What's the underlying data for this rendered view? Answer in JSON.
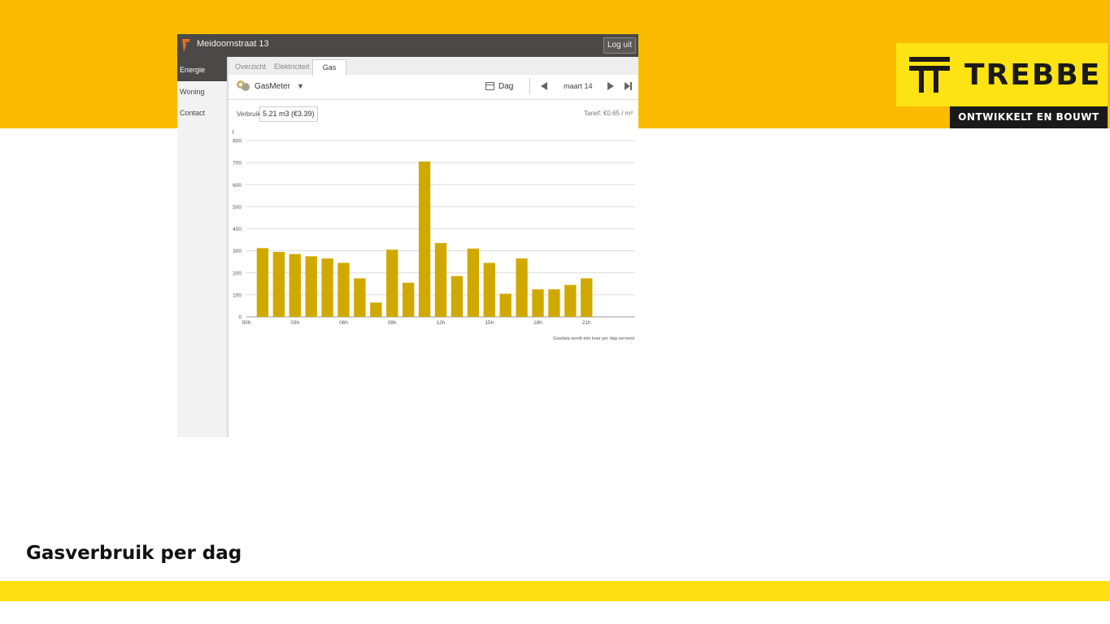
{
  "slide": {
    "caption": "Gasverbruik per dag",
    "colors": {
      "band_top": "#fbbb00",
      "band_bottom": "#fddf12",
      "logo_bg": "#fde313",
      "tag_bg": "#1a1a1a"
    }
  },
  "brand": {
    "name": "TREBBE",
    "tagline": "ONTWIKKELT EN BOUWT",
    "icon": "trebbe-logo-icon"
  },
  "app": {
    "title": "Meidoornstraat 13",
    "logout_label": "Log uit",
    "sidebar": {
      "items": [
        {
          "label": "Energie",
          "active": true
        },
        {
          "label": "Woning",
          "active": false
        },
        {
          "label": "Contact",
          "active": false
        }
      ]
    },
    "tabs": [
      {
        "label": "Overzicht",
        "active": false
      },
      {
        "label": "Elektriciteit",
        "active": false
      },
      {
        "label": "Gas",
        "active": true
      }
    ],
    "toolbar": {
      "meter_label": "GasMeter",
      "meter_icon": "gas-meter-icon",
      "period_label": "Dag",
      "date_label": "maart 14"
    },
    "usage": {
      "label": "Verbruik:",
      "value": "5.21 m3 (€3.39)",
      "tariff": "Tarief: €0.65 / m³"
    },
    "footnote": "Gasdata wordt één keer per dag ververst",
    "accent": "#d0a900"
  },
  "chart_data": {
    "type": "bar",
    "title": "",
    "xlabel": "",
    "ylabel": "l",
    "ylim": [
      0,
      800
    ],
    "yticks": [
      0,
      100,
      200,
      300,
      400,
      500,
      600,
      700,
      800
    ],
    "xtick_labels": [
      "00h",
      "03h",
      "06h",
      "09h",
      "12h",
      "15h",
      "18h",
      "21h"
    ],
    "xtick_hours": [
      0,
      3,
      6,
      9,
      12,
      15,
      18,
      21
    ],
    "hours": [
      1,
      2,
      3,
      4,
      5,
      6,
      7,
      8,
      9,
      10,
      11,
      12,
      13,
      14,
      15,
      16,
      17,
      18,
      19,
      20,
      21
    ],
    "values": [
      312,
      295,
      285,
      275,
      265,
      245,
      175,
      65,
      305,
      155,
      705,
      335,
      185,
      310,
      245,
      105,
      265,
      125,
      125,
      145,
      175
    ],
    "grid": true,
    "bar_color": "#d0a900"
  }
}
